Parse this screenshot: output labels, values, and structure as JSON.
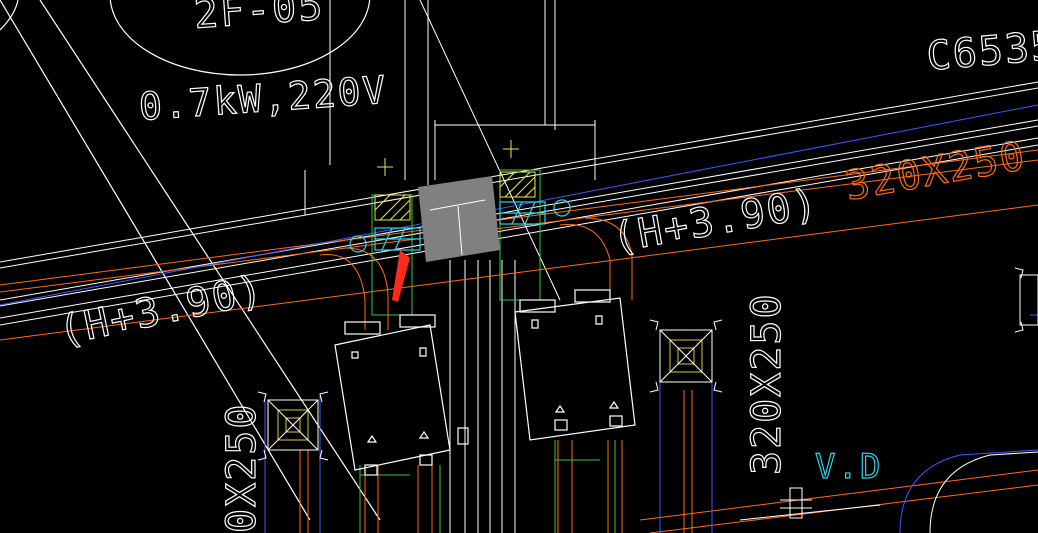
{
  "labels": {
    "equipment_id": "2F-05",
    "power": "0.7kW,220V",
    "drawing_code": "C6535",
    "duct_size_right": "320X250",
    "elevation_right": "(H+3.90)",
    "elevation_left": "(H+3.90)",
    "duct_size_vertical": "320X250",
    "duct_size_left": "0X250",
    "damper_tag": "V.D"
  },
  "colors": {
    "background": "#000000",
    "linework": "#ffffff",
    "duct_orange": "#ff6a1a",
    "duct_cyan": "#28d6e6",
    "duct_green": "#3fbf3f",
    "duct_blue": "#3a5cff",
    "hatch_yellow": "#e8e84a",
    "fill_gray": "#808080",
    "pointer_red": "#ff2a1a",
    "diffuser_yellow": "#d8c84a"
  }
}
